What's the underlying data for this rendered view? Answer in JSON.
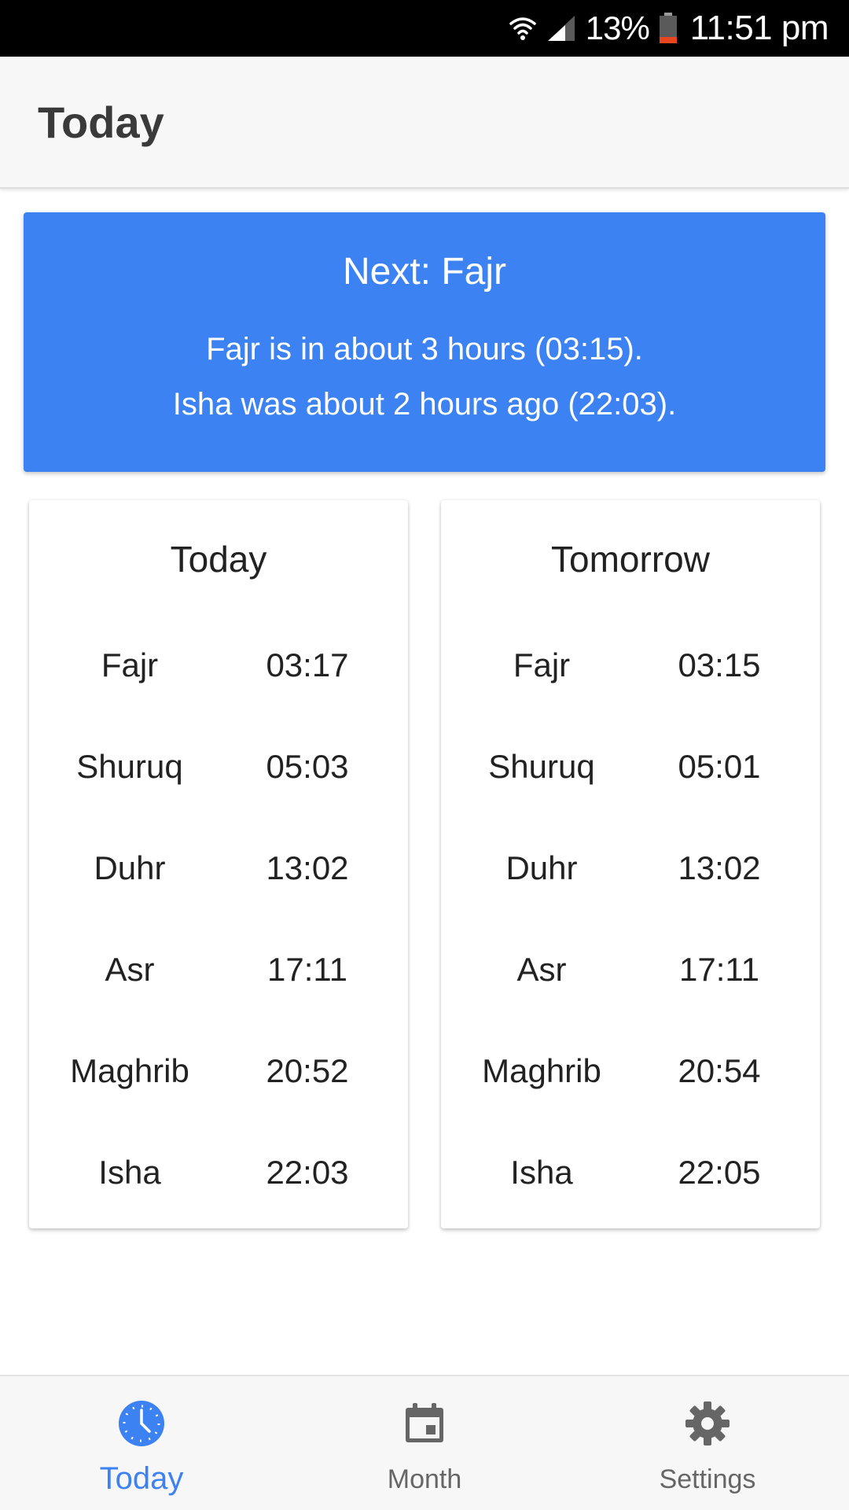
{
  "status_bar": {
    "battery_percent": "13%",
    "time": "11:51 pm",
    "icons": [
      "wifi-icon",
      "signal-icon",
      "battery-icon"
    ],
    "battery_color": "#e8461e"
  },
  "app_bar": {
    "title": "Today"
  },
  "next_prayer": {
    "title": "Next: Fajr",
    "line_1": "Fajr is in about 3 hours (03:15).",
    "line_2": "Isha was about 2 hours ago (22:03).",
    "color": "#3d82f2"
  },
  "schedules": [
    {
      "title": "Today",
      "rows": [
        {
          "name": "Fajr",
          "time": "03:17"
        },
        {
          "name": "Shuruq",
          "time": "05:03"
        },
        {
          "name": "Duhr",
          "time": "13:02"
        },
        {
          "name": "Asr",
          "time": "17:11"
        },
        {
          "name": "Maghrib",
          "time": "20:52"
        },
        {
          "name": "Isha",
          "time": "22:03"
        }
      ]
    },
    {
      "title": "Tomorrow",
      "rows": [
        {
          "name": "Fajr",
          "time": "03:15"
        },
        {
          "name": "Shuruq",
          "time": "05:01"
        },
        {
          "name": "Duhr",
          "time": "13:02"
        },
        {
          "name": "Asr",
          "time": "17:11"
        },
        {
          "name": "Maghrib",
          "time": "20:54"
        },
        {
          "name": "Isha",
          "time": "22:05"
        }
      ]
    }
  ],
  "bottom_nav": {
    "active": "Today",
    "active_color": "#3d82f2",
    "items": [
      {
        "label": "Today",
        "icon": "clock-icon"
      },
      {
        "label": "Month",
        "icon": "calendar-icon"
      },
      {
        "label": "Settings",
        "icon": "gear-icon"
      }
    ]
  }
}
